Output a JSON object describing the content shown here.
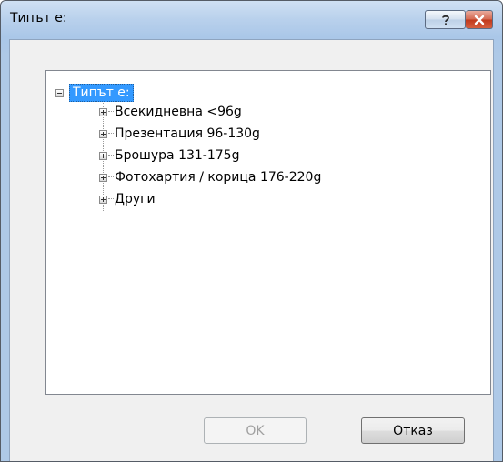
{
  "window": {
    "title": "Типът е:"
  },
  "caption_buttons": {
    "help_icon": "question-mark",
    "close_icon": "x"
  },
  "tree": {
    "root_label": "Типът е:",
    "items": [
      {
        "label": "Всекидневна <96g"
      },
      {
        "label": "Презентация 96-130g"
      },
      {
        "label": "Брошура 131-175g"
      },
      {
        "label": "Фотохартия / корица 176-220g"
      },
      {
        "label": "Други"
      }
    ]
  },
  "buttons": {
    "ok_label": "OK",
    "cancel_label": "Отказ"
  },
  "colors": {
    "selection": "#3399ff",
    "close_button": "#c1391c",
    "title_bar": "#b9d1ec"
  }
}
